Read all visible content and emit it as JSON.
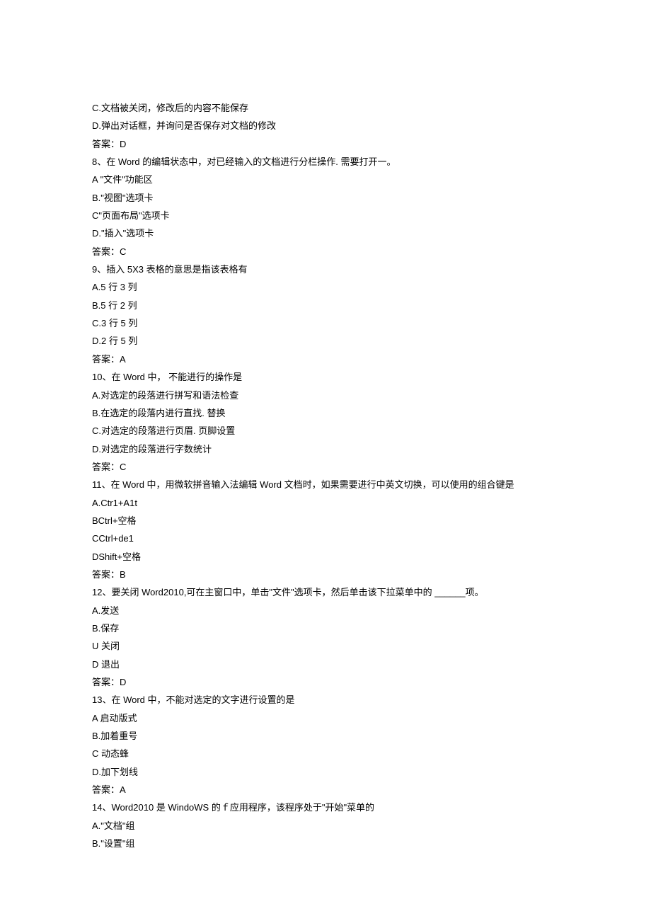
{
  "lines": [
    "C.文档被关闭，修改后的内容不能保存",
    "D.弹出对话框，并询问是否保存对文档的修改",
    "答案：D",
    "8、在 Word 的编辑状态中，对已经输入的文档进行分栏操作. 需要打开一。",
    "A \"文件\"功能区",
    "B.\"视图\"选项卡",
    "C\"页面布局\"选项卡",
    "D.\"插入\"选项卡",
    "答案：C",
    "9、插入 5X3 表格的意思是指该表格有",
    "A.5 行 3 列",
    "B.5 行 2 列",
    "C.3 行 5 列",
    "D.2 行 5 列",
    "答案：A",
    "10、在 Word 中， 不能进行的操作是",
    "A.对选定的段落进行拼写和语法检查",
    "B.在选定的段落内进行直找. 替换",
    "C.对选定的段落进行页眉. 页脚设置",
    "D.对选定的段落进行字数统计",
    "答案：C",
    "11、在 Word 中，用微软拼音输入法编辑 Word 文档时，如果需要进行中英文切换，可以使用的组合键是",
    "A.Ctr1+A1t",
    "BCtrl+空格",
    "CCtrl+de1",
    "DShift+空格",
    "答案：B",
    "12、要关闭 Word2010,可在主窗口中，单击\"文件\"选项卡，然后单击该下拉菜单中的 ______项。",
    "A.发送",
    "B.保存",
    "U 关闭",
    "D 退出",
    "答案：D",
    "13、在 Word 中，不能对选定的文字进行设置的是",
    "A 启动版式",
    "B.加着重号",
    "C 动态蜂",
    "D.加下划线",
    "答案：A",
    "14、Word2010 是 WindoWS 的ｆ应用程序，该程序处于\"开始\"菜单的",
    "A.\"文档\"组",
    "B.\"设置\"组"
  ]
}
